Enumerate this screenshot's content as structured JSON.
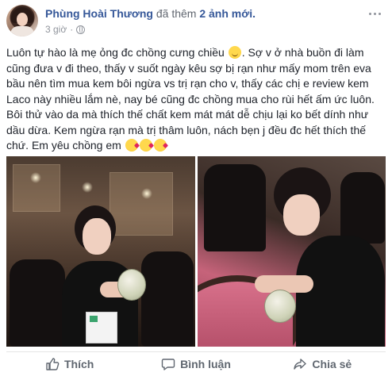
{
  "header": {
    "author_name": "Phùng Hoài Thương",
    "action_text": "đã thêm",
    "action_highlight": "2 ảnh mới.",
    "timestamp": "3 giờ",
    "separator": "·",
    "privacy_icon": "globe-icon",
    "more_icon": "more-options-icon"
  },
  "post": {
    "paragraph_1_a": "Luôn tự hào là mẹ ỏng đc chồng cưng chiều",
    "paragraph_1_b": ". Sợ v ở nhà buồn đi làm cũng đưa v đi theo, thấy v suốt ngày kêu sợ bị rạn như mấy mom trên eva bầu nên tìm mua kem bôi ngừa vs trị rạn cho v, thấy các chị e review kem Laco này nhiều lắm nè, nay bé cũng đc chồng mua cho rùi hết ấm ức luôn. Bôi thử vào da mà thích thế chất kem mát mát dễ chịu lại ko bết dính như dầu dừa. Kem ngừa rạn mà trị thâm luôn, nách bẹn j đều đc hết thích thế chứ. Em yêu chồng em",
    "emoji_smile": "smiling-face-emoji",
    "emoji_kiss": "face-blowing-kiss-emoji"
  },
  "photos": {
    "left": "photo-woman-holding-cream-jar",
    "right": "photo-woman-opening-cream-jar"
  },
  "actions": {
    "like_label": "Thích",
    "comment_label": "Bình luận",
    "share_label": "Chia sẻ",
    "like_icon": "thumbs-up-icon",
    "comment_icon": "comment-icon",
    "share_icon": "share-arrow-icon"
  },
  "colors": {
    "link_blue": "#365899",
    "meta_gray": "#90949c",
    "action_gray": "#606770",
    "text_dark": "#1d2129"
  }
}
